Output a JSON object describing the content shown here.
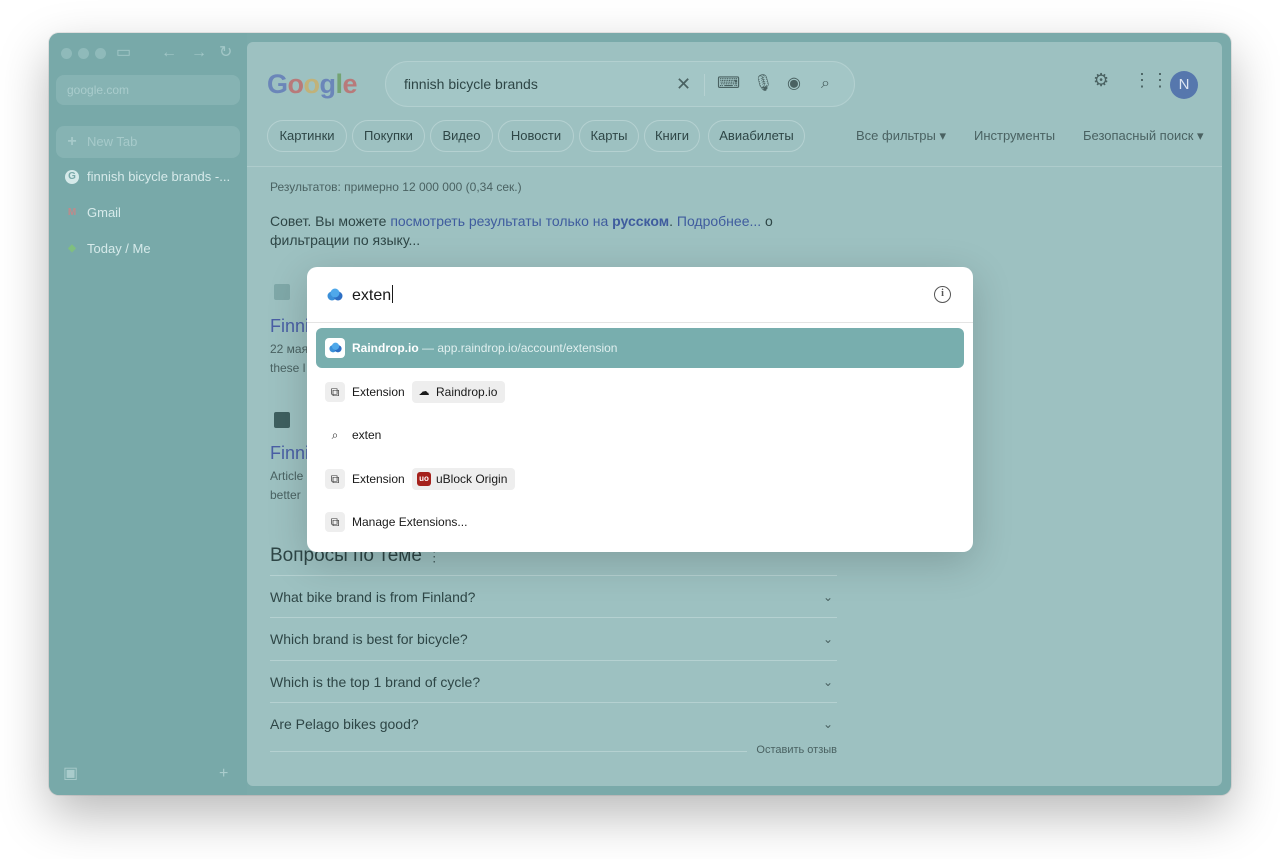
{
  "sidebar": {
    "url": "google.com",
    "tabs": [
      {
        "label": "New Tab",
        "icon": "plus-icon"
      },
      {
        "label": "finnish bicycle brands -...",
        "icon": "google-icon"
      },
      {
        "label": "Gmail",
        "icon": "gmail-icon"
      },
      {
        "label": "Today / Me",
        "icon": "linear-icon"
      }
    ]
  },
  "google": {
    "logo": [
      "G",
      "o",
      "o",
      "g",
      "l",
      "e"
    ],
    "query": "finnish bicycle brands",
    "avatar": "N",
    "chips": [
      "Картинки",
      "Покупки",
      "Видео",
      "Новости",
      "Карты",
      "Книги",
      "Авиабилеты"
    ],
    "filters": {
      "all_filters": "Все фильтры",
      "tools": "Инструменты",
      "safe_search": "Безопасный поиск"
    },
    "results_meta": "Результатов: примерно 12 000 000 (0,34 сек.)",
    "tip": {
      "prefix": "Совет. Вы можете",
      "link1": "посмотреть результаты только на",
      "lang": "русском",
      "link2": "Подробнее...",
      "suffix": "о фильтрации по языку..."
    },
    "result1": {
      "title": "Finni",
      "date": "22 мая",
      "snippet": "these l"
    },
    "result2": {
      "title": "Finni",
      "snippet1": "Article",
      "snippet2": "better"
    },
    "faq_heading": "Вопросы по теме",
    "faq": [
      "What bike brand is from Finland?",
      "Which brand is best for bicycle?",
      "Which is the top 1 brand of cycle?",
      "Are Pelago bikes good?"
    ],
    "feedback": "Оставить отзыв"
  },
  "palette": {
    "input_value": "exten",
    "rows": [
      {
        "label": "Raindrop.io",
        "url": " — app.raindrop.io/account/extension",
        "icon": "raindrop-icon",
        "selected": true
      },
      {
        "label": "Extension",
        "pill": "Raindrop.io",
        "pill_icon": "cloud-icon",
        "icon": "puzzle-icon"
      },
      {
        "label": "exten",
        "icon": "search-icon"
      },
      {
        "label": "Extension",
        "pill": "uBlock Origin",
        "pill_icon": "ublock-icon",
        "icon": "puzzle-icon"
      },
      {
        "label": "Manage Extensions...",
        "icon": "puzzle-icon"
      }
    ]
  },
  "colors": {
    "overlay": "#7aaaaa",
    "selected_row": "#78aeae",
    "avatar": "#5677ad"
  }
}
